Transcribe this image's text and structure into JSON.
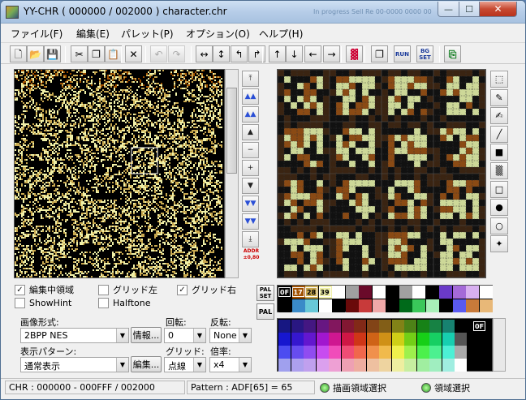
{
  "window": {
    "title": "YY-CHR ( 000000 / 002000 ) character.chr",
    "ghost_text": "In progress   Sell Re 00-0000 0000 00",
    "min": "—",
    "max": "☐",
    "close": "✕"
  },
  "menu": [
    "ファイル(F)",
    "編集(E)",
    "パレット(P)",
    "オプション(O)",
    "ヘルプ(H)"
  ],
  "toolbar": [
    {
      "name": "new-icon",
      "glyph": "🗋"
    },
    {
      "name": "open-icon",
      "glyph": "📂"
    },
    {
      "name": "save-icon",
      "glyph": "💾"
    },
    {
      "name": "cut-icon",
      "glyph": "✂"
    },
    {
      "name": "copy-icon",
      "glyph": "❐"
    },
    {
      "name": "paste-icon",
      "glyph": "📋"
    },
    {
      "name": "delete-icon",
      "glyph": "✕"
    },
    {
      "name": "undo-icon",
      "glyph": "↶"
    },
    {
      "name": "redo-icon",
      "glyph": "↷"
    },
    {
      "name": "flip-horizontal-icon",
      "glyph": "↔"
    },
    {
      "name": "flip-vertical-icon",
      "glyph": "↕"
    },
    {
      "name": "rotate-left-icon",
      "glyph": "↰"
    },
    {
      "name": "rotate-right-icon",
      "glyph": "↱"
    },
    {
      "name": "shift-up-icon",
      "glyph": "↑"
    },
    {
      "name": "shift-down-icon",
      "glyph": "↓"
    },
    {
      "name": "shift-left-icon",
      "glyph": "←"
    },
    {
      "name": "shift-right-icon",
      "glyph": "→"
    },
    {
      "name": "palette-replace-icon",
      "glyph": "▓"
    },
    {
      "name": "pattern-export-icon",
      "glyph": "❐"
    },
    {
      "name": "run-icon",
      "glyph": "RUN"
    },
    {
      "name": "bg-set-icon",
      "glyph": "BG SET"
    },
    {
      "name": "exit-icon",
      "glyph": "⎘"
    }
  ],
  "nav": [
    {
      "name": "scroll-top-icon",
      "glyph": "⤒"
    },
    {
      "name": "page-up-fast-icon",
      "glyph": "▲▲"
    },
    {
      "name": "page-up-icon",
      "glyph": "▲▲"
    },
    {
      "name": "line-up-icon",
      "glyph": "▲"
    },
    {
      "name": "byte-up-icon",
      "glyph": "−"
    },
    {
      "name": "byte-down-icon",
      "glyph": "+"
    },
    {
      "name": "line-down-icon",
      "glyph": "▼"
    },
    {
      "name": "page-down-icon",
      "glyph": "▼▼"
    },
    {
      "name": "page-down-fast-icon",
      "glyph": "▼▼"
    },
    {
      "name": "scroll-bottom-icon",
      "glyph": "⤓"
    }
  ],
  "addr_label": "ADDR ±0,80",
  "tools": [
    {
      "name": "select-tool-icon",
      "glyph": "⬚"
    },
    {
      "name": "pen-tool-icon",
      "glyph": "✎"
    },
    {
      "name": "brush-tool-icon",
      "glyph": "✍"
    },
    {
      "name": "line-tool-icon",
      "glyph": "╱"
    },
    {
      "name": "filled-rect-tool-icon",
      "glyph": "■"
    },
    {
      "name": "pattern-fill-tool-icon",
      "glyph": "▒"
    },
    {
      "name": "rect-tool-icon",
      "glyph": "□"
    },
    {
      "name": "filled-circle-tool-icon",
      "glyph": "●"
    },
    {
      "name": "circle-tool-icon",
      "glyph": "○"
    },
    {
      "name": "fill-tool-icon",
      "glyph": "✦"
    }
  ],
  "options": {
    "edit_area": {
      "label": "編集中領域",
      "checked": true
    },
    "grid_left": {
      "label": "グリッド左",
      "checked": false
    },
    "grid_right": {
      "label": "グリッド右",
      "checked": true
    },
    "show_hint": {
      "label": "ShowHint",
      "checked": false
    },
    "halftone": {
      "label": "Halftone",
      "checked": false
    }
  },
  "form": {
    "image_format_label": "画像形式:",
    "image_format_value": "2BPP NES",
    "info_button": "情報...",
    "rotate_label": "回転:",
    "rotate_value": "0",
    "flip_label": "反転:",
    "flip_value": "None",
    "display_pattern_label": "表示パターン:",
    "display_pattern_value": "通常表示",
    "edit_button": "編集...",
    "grid_label": "グリッド:",
    "grid_value": "点線",
    "zoom_label": "倍率:",
    "zoom_value": "x4"
  },
  "palette": {
    "palset_label": "PAL SET",
    "pal_label": "PAL",
    "index_tags": [
      "0F",
      "17",
      "28",
      "39"
    ],
    "big_tag": "0F",
    "top_row": [
      "#000000",
      "#a05000",
      "#c8a850",
      "#f0f0a8",
      "#ffffff",
      "#a0a0a0",
      "#6a0a2a",
      "#ffffff",
      "#000000",
      "#a0a0a0",
      "#ffffff",
      "#000000",
      "#6a3ac8",
      "#a46ad8",
      "#d8b0f0",
      "#ffffff"
    ],
    "bottom_row": [
      "#000000",
      "#3a8ac8",
      "#68c8d8",
      "#ffffff",
      "#000000",
      "#6a0a0a",
      "#c83a3a",
      "#f0a8a8",
      "#000000",
      "#006a1a",
      "#3ac85a",
      "#a8f0b8",
      "#000000",
      "#5a5af0",
      "#c87a3a",
      "#e8b878"
    ]
  },
  "status": {
    "chr_range": "CHR : 000000 - 000FFF / 002000",
    "pattern": "Pattern : ADF[65] = 65",
    "draw_select": "描画領域選択",
    "area_select": "領域選択"
  }
}
